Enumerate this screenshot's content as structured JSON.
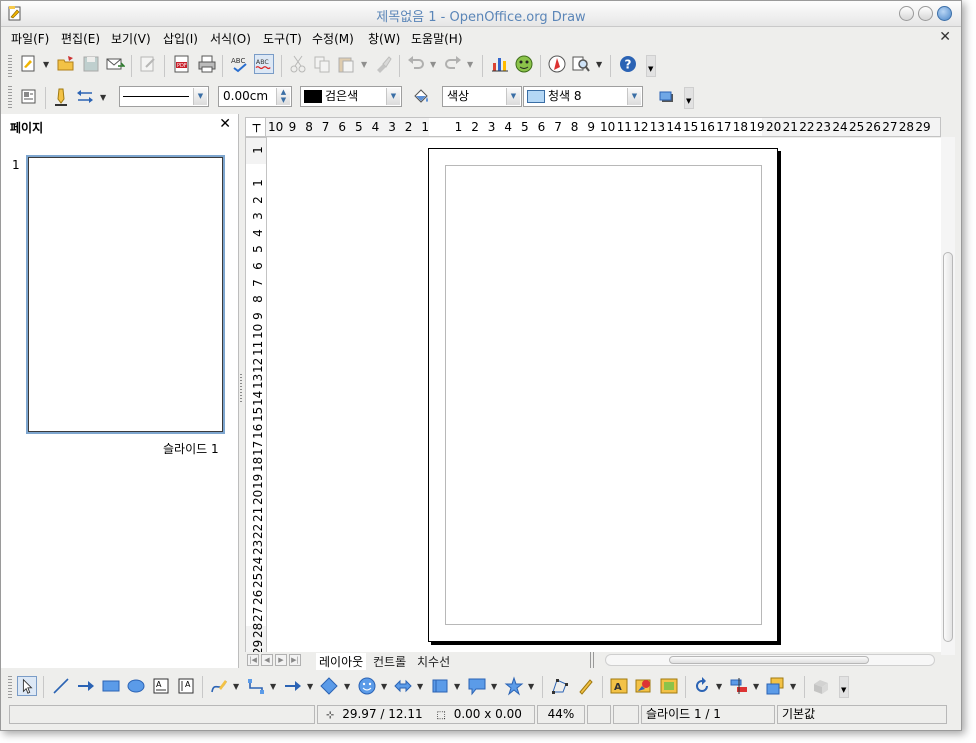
{
  "window": {
    "title": "제목없음 1 - OpenOffice.org Draw"
  },
  "menu": {
    "items": [
      "파일(F)",
      "편집(E)",
      "보기(V)",
      "삽입(I)",
      "서식(O)",
      "도구(T)",
      "수정(M)",
      "창(W)",
      "도움말(H)"
    ]
  },
  "line_toolbar": {
    "line_width": "0.00cm",
    "line_color": "검은색",
    "area_style": "색상",
    "area_color": "청색 8"
  },
  "slide_pane": {
    "title": "페이지",
    "slide_number": "1",
    "slide_label": "슬라이드 1"
  },
  "rulers": {
    "horizontal_ticks": [
      "10",
      "9",
      "8",
      "7",
      "6",
      "5",
      "4",
      "3",
      "2",
      "1",
      "",
      "1",
      "2",
      "3",
      "4",
      "5",
      "6",
      "7",
      "8",
      "9",
      "10",
      "11",
      "12",
      "13",
      "14",
      "15",
      "16",
      "17",
      "18",
      "19",
      "20",
      "21",
      "22",
      "23",
      "24",
      "25",
      "26",
      "27",
      "28",
      "29"
    ],
    "vertical_ticks": [
      "1",
      "1",
      "2",
      "3",
      "4",
      "5",
      "6",
      "7",
      "8",
      "9",
      "10",
      "11",
      "12",
      "13",
      "14",
      "15",
      "16",
      "17",
      "18",
      "19",
      "20",
      "21",
      "22",
      "23",
      "24",
      "25",
      "26",
      "27",
      "28",
      "29"
    ]
  },
  "layer_tabs": [
    "레이아웃",
    "컨트롤",
    "치수선"
  ],
  "status": {
    "position": "29.97 / 12.11",
    "size": "0.00 x 0.00",
    "zoom": "44%",
    "slide": "슬라이드 1 / 1",
    "layout": "기본값"
  },
  "colors": {
    "accent": "#4a86c8",
    "title_text": "#5b86b8",
    "line_color_swatch": "#000000",
    "area_color_swatch": "#b4d7f5"
  }
}
